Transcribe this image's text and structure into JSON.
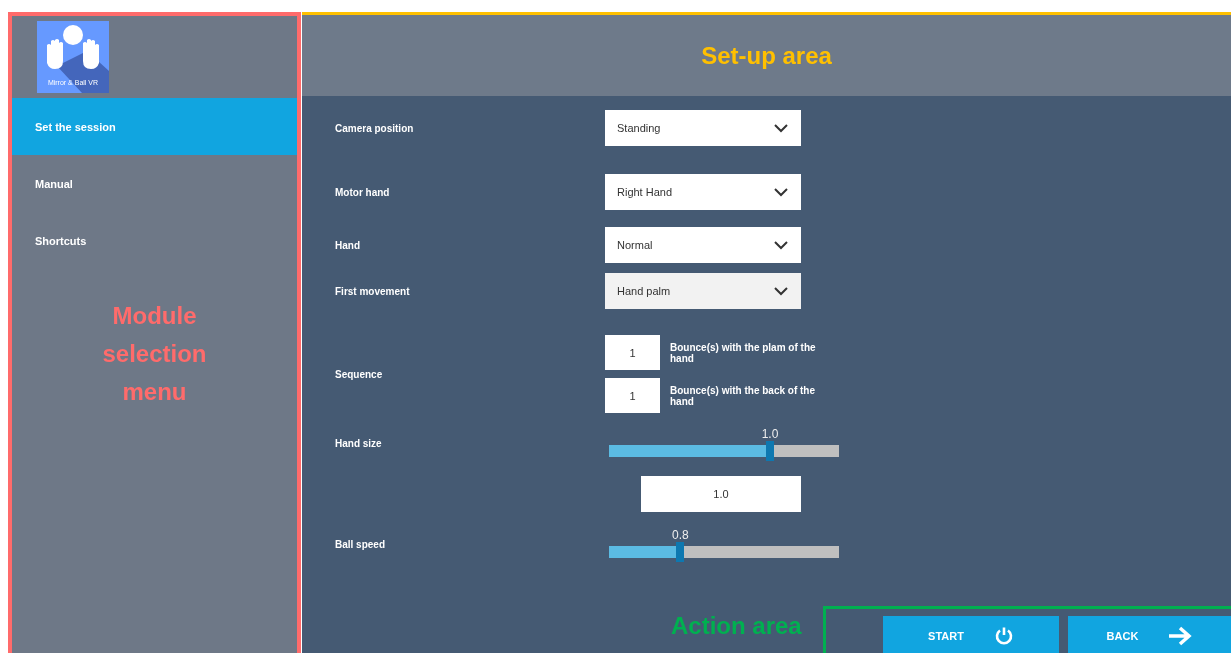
{
  "sidebar": {
    "logo_text": "Mirror & Ball VR",
    "items": [
      {
        "label": "Set the session",
        "selected": true
      },
      {
        "label": "Manual",
        "selected": false
      },
      {
        "label": "Shortcuts",
        "selected": false
      }
    ]
  },
  "fields": [
    {
      "kind": "dropdown",
      "label": "Camera position",
      "value": "Standing",
      "highlighted": false
    },
    {
      "kind": "dropdown",
      "label": "Motor hand",
      "value": "Right Hand",
      "highlighted": false
    },
    {
      "kind": "dropdown",
      "label": "Hand",
      "value": "Normal",
      "highlighted": false
    },
    {
      "kind": "dropdown",
      "label": "First movement",
      "value": "Hand palm",
      "highlighted": true
    },
    {
      "kind": "sequence",
      "label": "Sequence",
      "entries": [
        {
          "value": "1",
          "caption": "Bounce(s) with the plam of the hand"
        },
        {
          "value": "1",
          "caption": "Bounce(s) with the back of the hand"
        }
      ]
    },
    {
      "kind": "slider",
      "label": "Hand size",
      "level": 0.7,
      "reading": "1.0"
    },
    {
      "kind": "number",
      "value": "1.0"
    },
    {
      "kind": "slider",
      "label": "Ball speed",
      "level": 0.31,
      "reading": "0.8"
    }
  ],
  "actions": [
    {
      "label": "START",
      "kind": "start"
    },
    {
      "label": "BACK",
      "kind": "back"
    }
  ],
  "annotations": [
    {
      "kind": "setup",
      "text": "Set-up area",
      "color": "#ffc000"
    },
    {
      "kind": "module",
      "text": "Module selection menu",
      "color": "#ff6b6b"
    },
    {
      "kind": "action",
      "text": "Action area",
      "color": "#00b050"
    }
  ]
}
